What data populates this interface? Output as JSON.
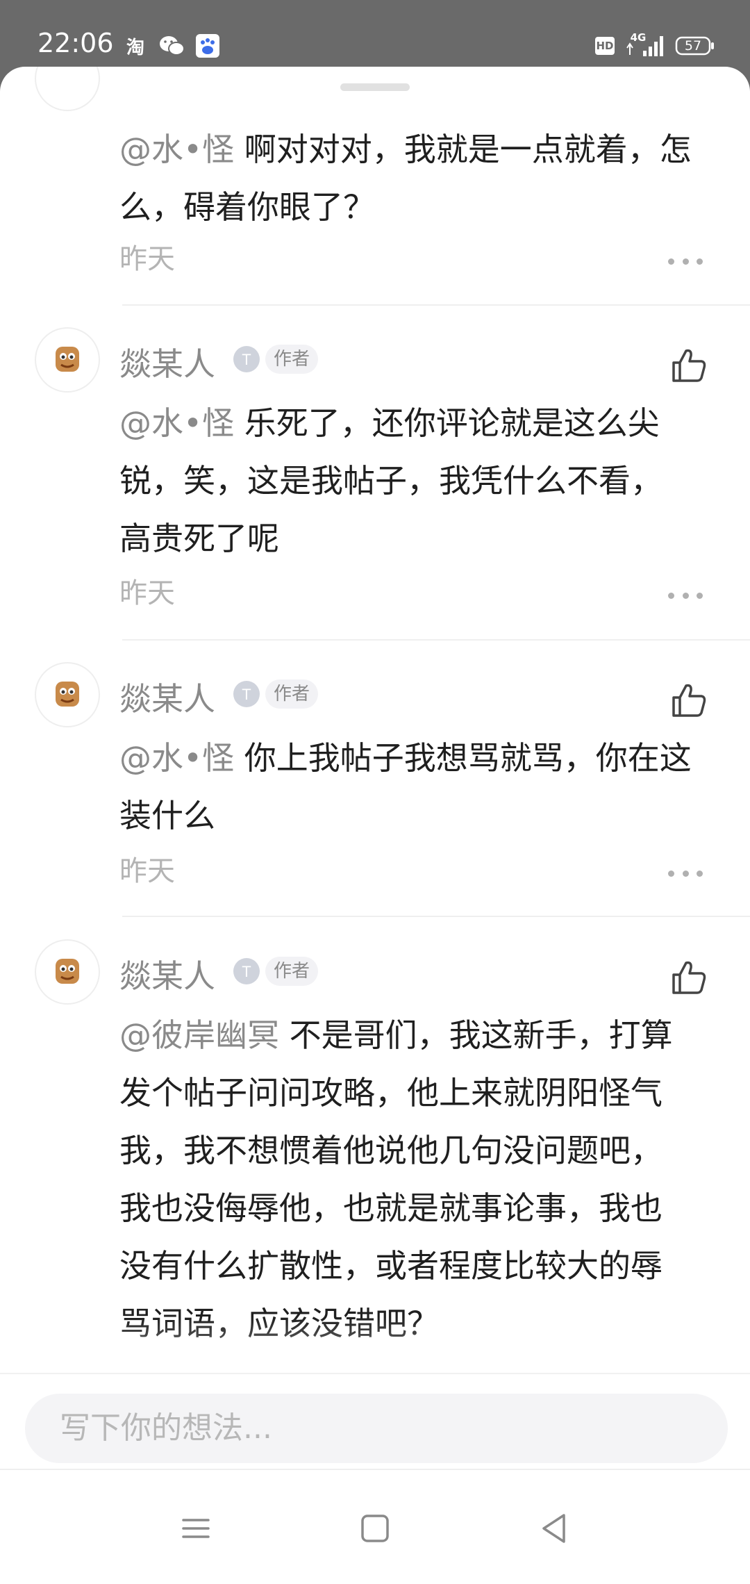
{
  "status": {
    "time": "22:06",
    "icons": [
      "taobao-icon",
      "wechat-icon",
      "baidu-icon",
      "hd-icon",
      "signal-4g-icon",
      "battery-icon"
    ],
    "taobao_glyph": "淘",
    "hd_label": "HD",
    "network_label": "4G",
    "battery": "57"
  },
  "comments": [
    {
      "mention": "@水•怪",
      "text": "啊对对对，我就是一点就着，怎么，碍着你眼了？",
      "lines": [
        "@水•怪  啊对对对，我就是一点就着，怎",
        "么，碍着你眼了？"
      ],
      "date": "昨天"
    },
    {
      "author": "燚某人",
      "badge": "作者",
      "level_icon": "level-badge-icon",
      "mention": "@水•怪",
      "lines": [
        "@水•怪  乐死了，还你评论就是这么尖",
        "锐，笑，这是我帖子，我凭什么不看，",
        "高贵死了呢"
      ],
      "date": "昨天"
    },
    {
      "author": "燚某人",
      "badge": "作者",
      "level_icon": "level-badge-icon",
      "mention": "@水•怪",
      "lines": [
        "@水•怪  你上我帖子我想骂就骂，你在这",
        "装什么"
      ],
      "date": "昨天"
    },
    {
      "author": "燚某人",
      "badge": "作者",
      "level_icon": "level-badge-icon",
      "mention": "@彼岸幽冥",
      "lines": [
        "@彼岸幽冥  不是哥们，我这新手，打算",
        "发个帖子问问攻略，他上来就阴阳怪气",
        "我，我不想惯着他说他几句没问题吧，",
        "我也没侮辱他，也就是就事论事，我也",
        "没有什么扩散性，或者程度比较大的辱",
        "骂词语，应该没错吧？"
      ]
    }
  ],
  "input": {
    "placeholder": "写下你的想法..."
  },
  "navbar": [
    "menu-icon",
    "home-square-icon",
    "back-triangle-icon"
  ],
  "colors": {
    "statusbar": "#6a6a6a",
    "text": "#1f1f1f",
    "muted": "#8a8a8a",
    "date": "#b4b4b4"
  }
}
